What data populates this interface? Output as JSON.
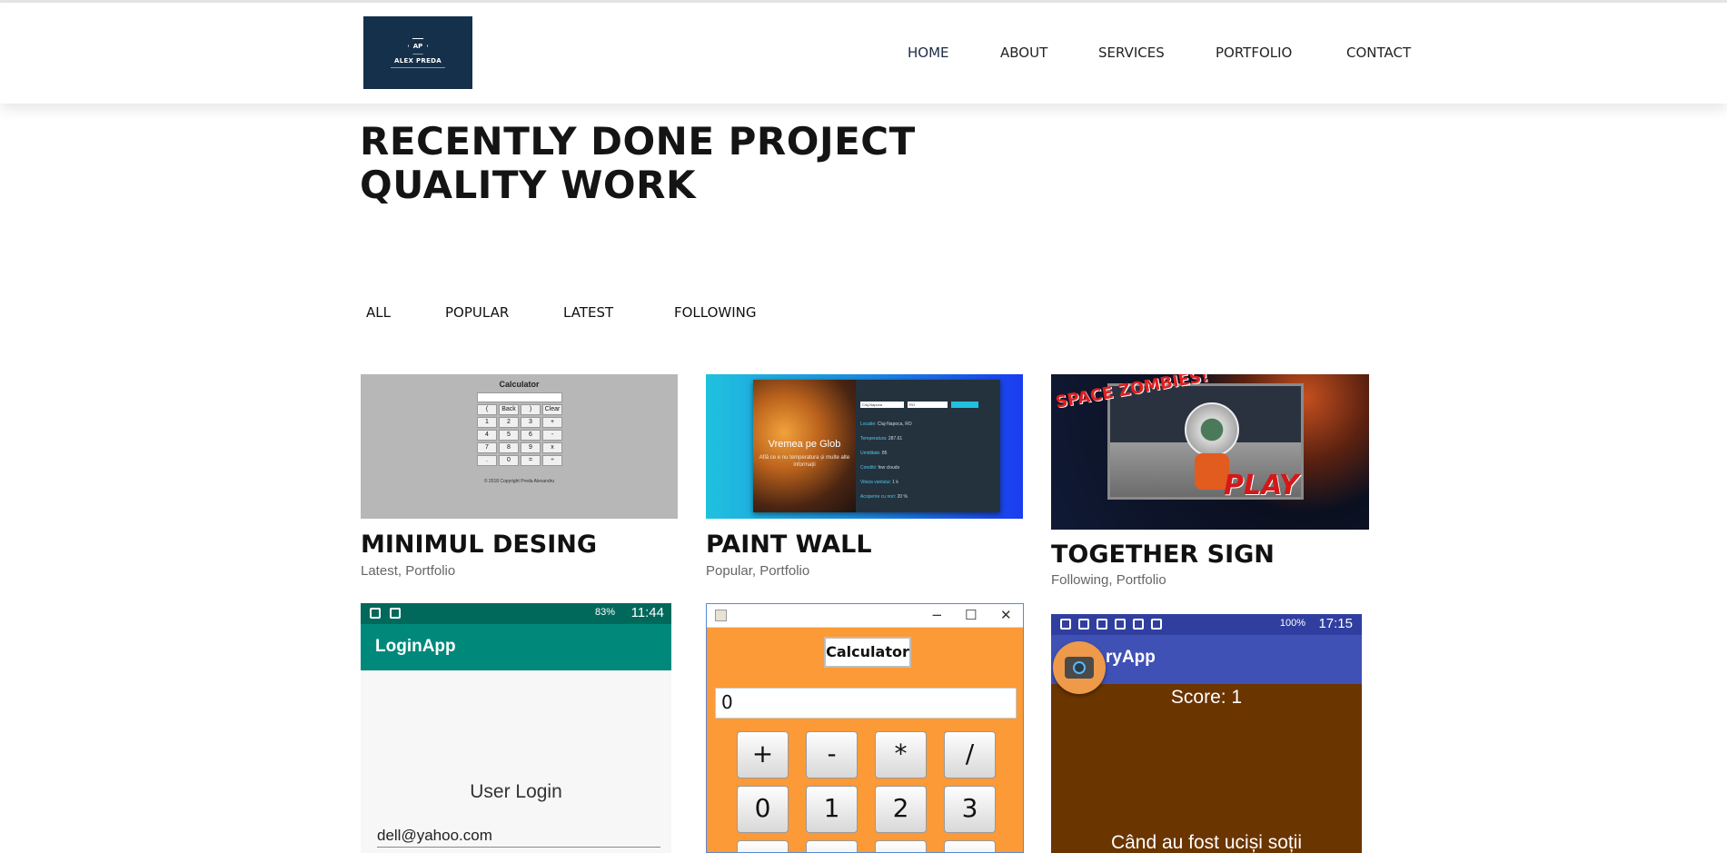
{
  "brand": {
    "logo_initials": "AP",
    "logo_name": "ALEX PREDA",
    "color": "#15304b"
  },
  "nav": [
    {
      "label": "HOME"
    },
    {
      "label": "ABOUT"
    },
    {
      "label": "SERVICES"
    },
    {
      "label": "PORTFOLIO"
    },
    {
      "label": "CONTACT"
    }
  ],
  "hero": {
    "line1": "RECENTLY DONE PROJECT",
    "line2": "QUALITY WORK"
  },
  "filters": [
    {
      "label": "ALL"
    },
    {
      "label": "POPULAR"
    },
    {
      "label": "LATEST"
    },
    {
      "label": "FOLLOWING"
    }
  ],
  "projects": [
    {
      "title": "MINIMUL DESING",
      "tags": "Latest, Portfolio"
    },
    {
      "title": "PAINT WALL",
      "tags": "Popular, Portfolio"
    },
    {
      "title": "TOGETHER SIGN",
      "tags": "Following, Portfolio"
    }
  ],
  "thumbs": {
    "calc": {
      "title": "Calculator",
      "keys": [
        "(",
        "Back",
        ")",
        "Clear",
        "1",
        "2",
        "3",
        "+",
        "4",
        "5",
        "6",
        "-",
        "7",
        "8",
        "9",
        "x",
        ".",
        "0",
        "=",
        "÷"
      ],
      "footer": "© 2018 Copyright Preda Alexandru"
    },
    "weather": {
      "title": "Vremea pe Glob",
      "subtitle": "Află ce e nu temperatura și multe alte informații",
      "input_value": "Cluj-Napoca",
      "input2_value": "RO",
      "rows": [
        {
          "label": "Locatie:",
          "value": "Cluj-Napoca, RO"
        },
        {
          "label": "Temperatura:",
          "value": "287.61"
        },
        {
          "label": "Umiditate:",
          "value": "85"
        },
        {
          "label": "Conditii:",
          "value": "few clouds"
        },
        {
          "label": "Viteza vantului:",
          "value": "1 k"
        },
        {
          "label": "Acoperire cu nori:",
          "value": "20 %"
        }
      ]
    },
    "game": {
      "logo": "SPACE ZOMBIES!",
      "play": "PLAY"
    },
    "login": {
      "battery": "83%",
      "time": "11:44",
      "app_title": "LoginApp",
      "heading": "User Login",
      "email": "dell@yahoo.com"
    },
    "jcalc": {
      "name": "Calculator",
      "display": "0",
      "keys": [
        "+",
        "-",
        "*",
        "/",
        "0",
        "1",
        "2",
        "3",
        "",
        "",
        "",
        ""
      ]
    },
    "quiz": {
      "battery": "100%",
      "time": "17:15",
      "app_title": "ryApp",
      "score": "Score: 1",
      "question": "Când au fost uciși soții"
    }
  }
}
